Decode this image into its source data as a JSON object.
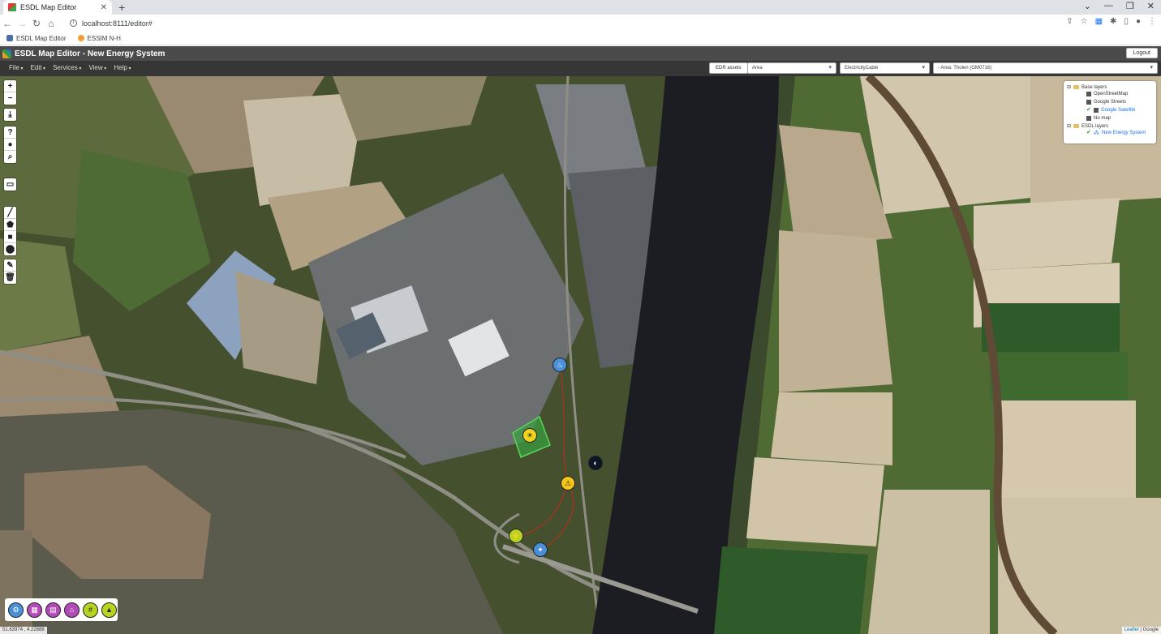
{
  "browser": {
    "tab_title": "ESDL Map Editor",
    "tab_close": "✕",
    "new_tab": "+",
    "url": "localhost:8111/editor#",
    "window_controls": [
      "⌄",
      "—",
      "❐",
      "✕"
    ],
    "bookmarks": [
      {
        "label": "ESDL Map Editor",
        "icon": "esdl-icon"
      },
      {
        "label": "ESSIM N-H",
        "icon": "essim-icon"
      }
    ]
  },
  "app": {
    "title": "ESDL Map Editor - New Energy System",
    "logout_label": "Logout",
    "menu": [
      "File",
      "Edit",
      "Services",
      "View",
      "Help"
    ],
    "edr_assets_label": "EDR assets",
    "area_select": "Area",
    "cable_select": "ElectricityCable",
    "region_select": "- Area: Tholen (GM0716)"
  },
  "map": {
    "zoom_in": "+",
    "zoom_out": "−",
    "layers": {
      "base_group": "Base layers",
      "base_items": [
        "OpenStreetMap",
        "Google Streets",
        "Google Satellite",
        "No map"
      ],
      "selected_base": "Google Satellite",
      "esdl_group": "ESDL layers",
      "esdl_items": [
        "New Energy System"
      ]
    },
    "coords": "51.63974 , 4.22688",
    "attribution_leaflet": "Leaflet",
    "attribution_google": "Google",
    "palette_icons": [
      "heatpump-icon",
      "storage-icon",
      "battery-icon",
      "building-icon",
      "pv-icon",
      "producer-icon"
    ],
    "colors": {
      "water": "#1c1d22",
      "field_green": "#3e5a2a",
      "field_brown": "#8a7760",
      "industrial": "#6b6e72"
    }
  }
}
